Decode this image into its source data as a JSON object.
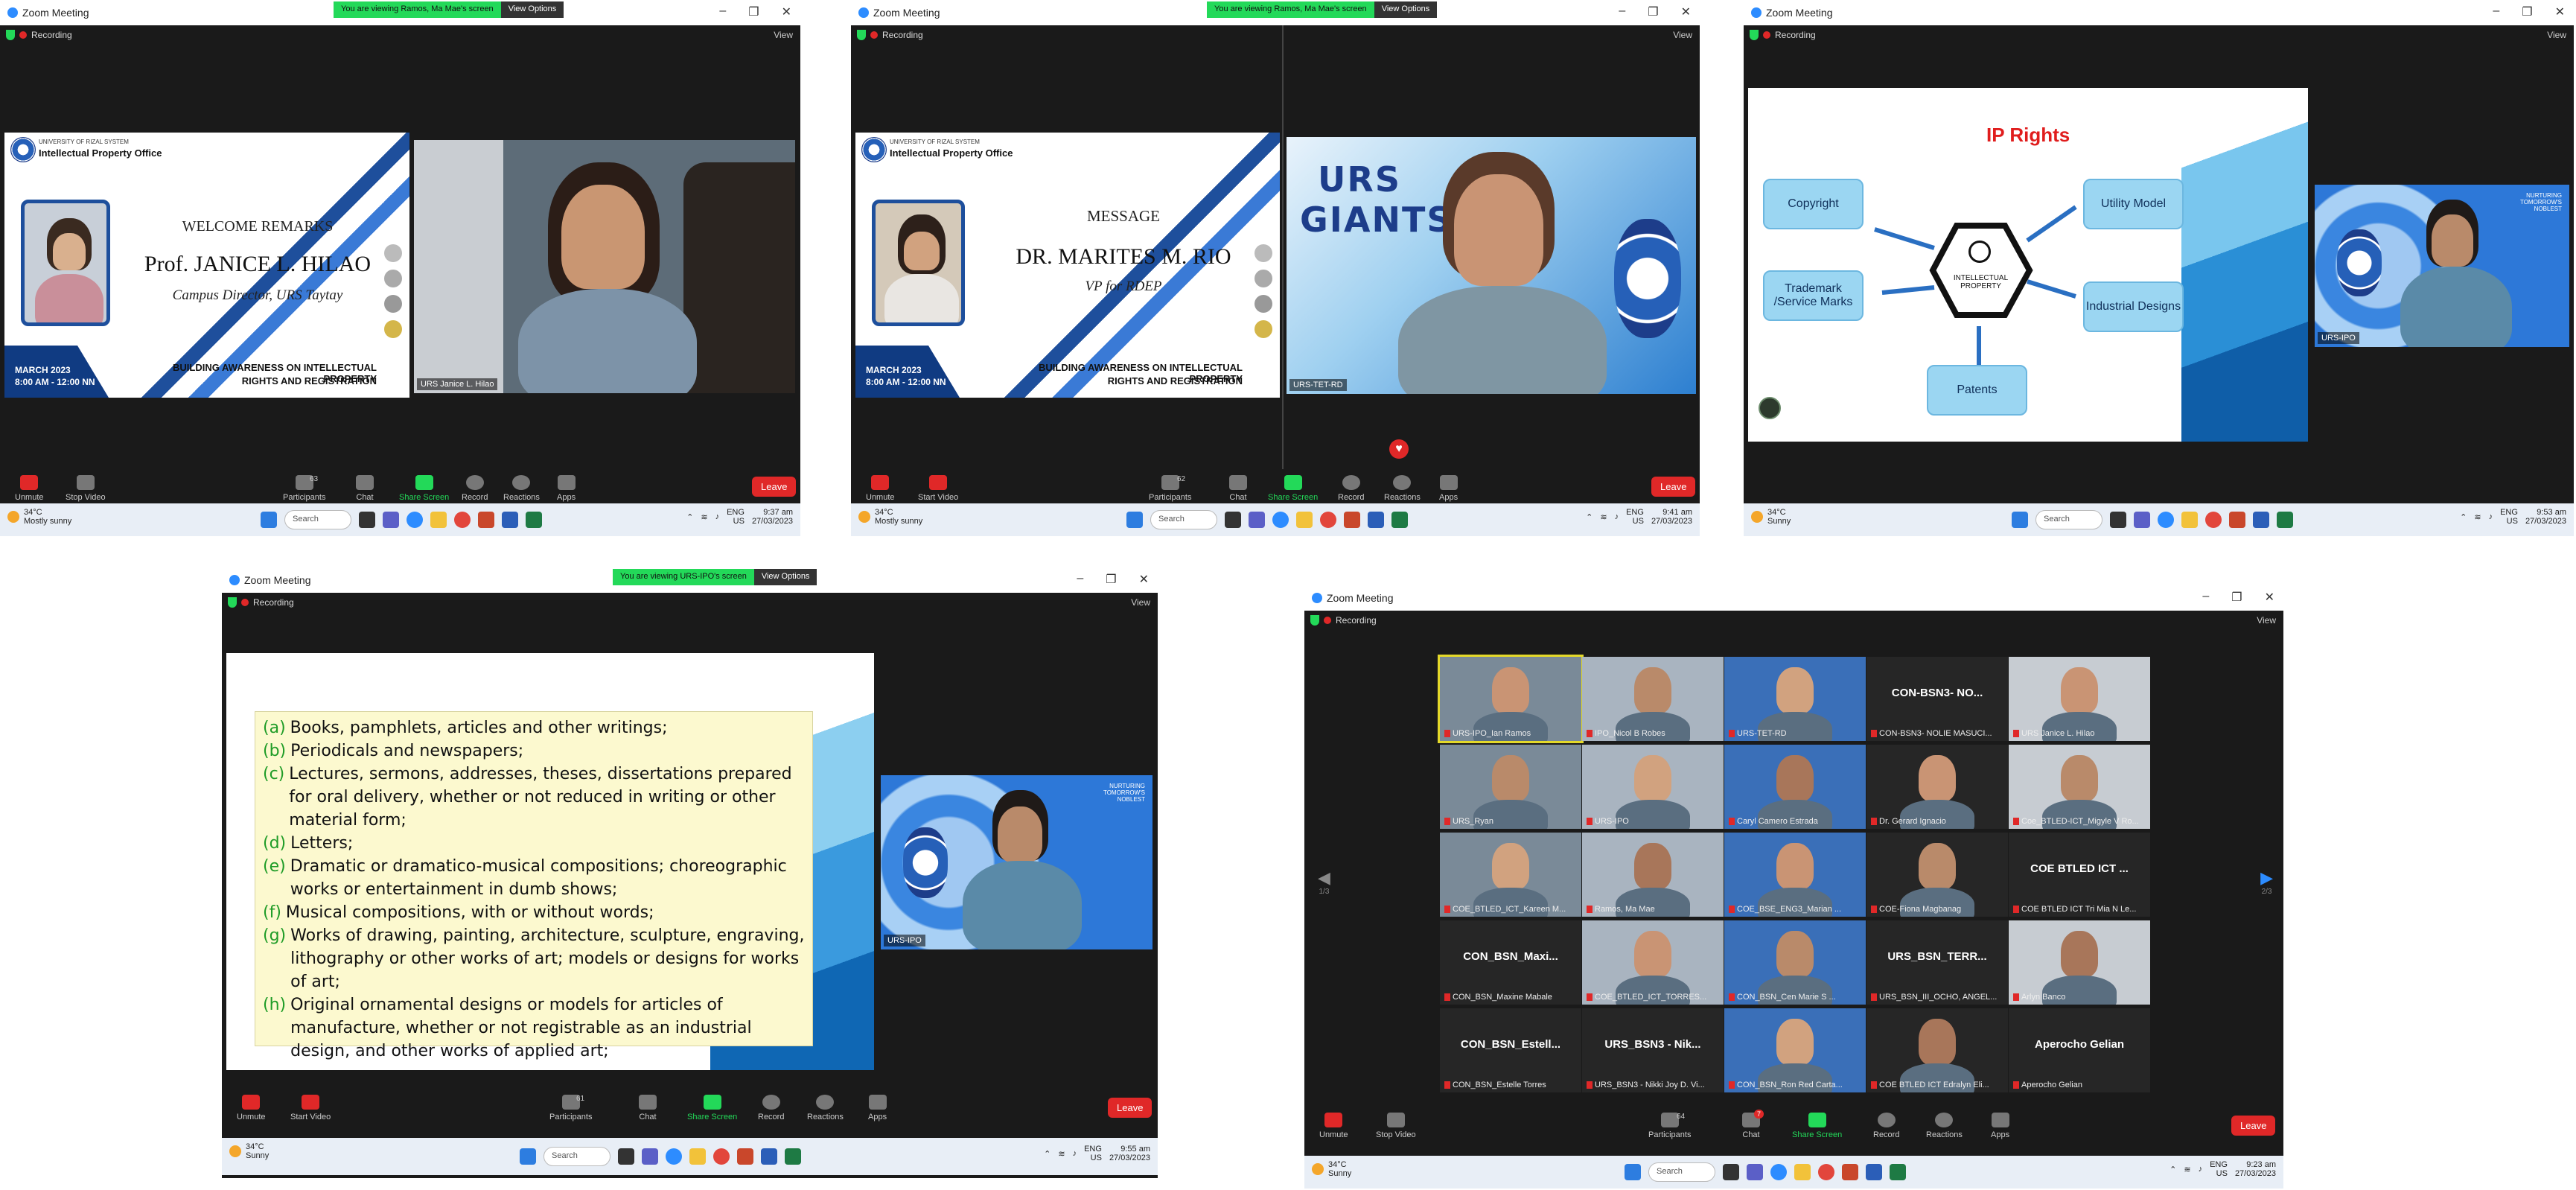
{
  "common": {
    "app_title": "Zoom Meeting",
    "recording": "Recording",
    "view": "View",
    "view_options": "View Options",
    "leave": "Leave",
    "toolbar": {
      "unmute": "Unmute",
      "stop_video": "Stop Video",
      "start_video": "Start Video",
      "participants": "Participants",
      "chat": "Chat",
      "share_screen": "Share Screen",
      "record": "Record",
      "reactions": "Reactions",
      "apps": "Apps"
    },
    "taskbar": {
      "search": "Search",
      "lang": "ENG",
      "region": "US",
      "date": "27/03/2023"
    }
  },
  "panel1": {
    "share_notice": "You are viewing Ramos, Ma Mae's screen",
    "participants_count": "63",
    "slide": {
      "university": "UNIVERSITY OF RIZAL SYSTEM",
      "office": "Intellectual Property Office",
      "heading": "WELCOME REMARKS",
      "speaker": "Prof. JANICE L. HILAO",
      "role": "Campus Director, URS Taytay",
      "date1": "MARCH 2023",
      "date2": "8:00 AM - 12:00 NN",
      "event1": "BUILDING AWARENESS ON INTELLECTUAL PROPERTY",
      "event2": "RIGHTS AND REGISTRATION"
    },
    "video_label": "URS Janice L. Hilao",
    "weather_temp": "34°C",
    "weather_desc": "Mostly sunny",
    "time": "9:37 am"
  },
  "panel2": {
    "share_notice": "You are viewing Ramos, Ma Mae's screen",
    "participants_count": "62",
    "slide": {
      "university": "UNIVERSITY OF RIZAL SYSTEM",
      "office": "Intellectual Property Office",
      "heading": "MESSAGE",
      "speaker": "DR. MARITES M. RIO",
      "role": "VP for RDEP",
      "date1": "MARCH 2023",
      "date2": "8:00 AM - 12:00 NN",
      "event1": "BUILDING AWARENESS ON INTELLECTUAL PROPERTY",
      "event2": "RIGHTS AND REGISTRATION"
    },
    "video_label": "URS-TET-RD",
    "video_logo": "URS GIANTS",
    "weather_temp": "34°C",
    "weather_desc": "Mostly sunny",
    "time": "9:41 am"
  },
  "panel3": {
    "slide": {
      "title": "IP Rights",
      "center": "INTELLECTUAL PROPERTY",
      "copyright": "Copyright",
      "trademark": "Trademark /Service Marks",
      "patents": "Patents",
      "utility": "Utility Model",
      "industrial": "Industrial Designs"
    },
    "video_label": "URS-IPO",
    "video_banner": "NURTURING TOMORROW'S NOBLEST",
    "weather_temp": "34°C",
    "weather_desc": "Sunny",
    "time": "9:53 am"
  },
  "panel4": {
    "share_notice": "You are viewing URS-IPO's screen",
    "participants_count": "61",
    "slide_items": [
      {
        "letter": "(a)",
        "text": "Books, pamphlets, articles and other writings;"
      },
      {
        "letter": "(b)",
        "text": "Periodicals and newspapers;"
      },
      {
        "letter": "(c)",
        "text": "Lectures, sermons, addresses, theses, dissertations prepared for oral delivery,  whether or not reduced in writing or other material form;"
      },
      {
        "letter": "(d)",
        "text": "Letters;"
      },
      {
        "letter": "(e)",
        "text": "Dramatic or dramatico-musical compositions; choreographic works or entertainment in dumb shows;"
      },
      {
        "letter": "(f)",
        "text": "Musical compositions, with or without words;"
      },
      {
        "letter": "(g)",
        "text": "Works of drawing, painting, architecture, sculpture, engraving, lithography or other works of art; models or designs for works of art;"
      },
      {
        "letter": "(h)",
        "text": "Original ornamental designs or models for articles of manufacture, whether  or not registrable as an industrial design, and other works of applied art;"
      }
    ],
    "video_label": "URS-IPO",
    "video_banner": "NURTURING TOMORROW'S NOBLEST",
    "weather_temp": "34°C",
    "weather_desc": "Sunny",
    "time": "9:55 am"
  },
  "panel5": {
    "participants_count": "64",
    "chat_badge": "7",
    "page_left": "1/3",
    "page_right": "2/3",
    "tiles": [
      "URS-IPO_Ian Ramos",
      "IPO_Nicol B Robes",
      "URS-TET-RD",
      "CON-BSN3- NOLIE MASUCI...",
      "URS Janice L. Hilao",
      "URS_Ryan",
      "URS-IPO",
      "Caryl Camero Estrada",
      "Dr. Gerard Ignacio",
      "Coe_BTLED-ICT_Migyle V Ro...",
      "COE_BTLED_ICT_Kareen M...",
      "Ramos, Ma Mae",
      "COE_BSE_ENG3_Marian ...",
      "COE-Fiona Magbanag",
      "COE BTLED ICT Tri Mia N Le...",
      "CON_BSN_Maxine Mabale",
      "COE_BTLED_ICT_TORRES...",
      "CON_BSN_Cen Marie S ...",
      "URS_BSN_III_OCHO, ANGEL...",
      "Arlyn Banco",
      "CON_BSN_Estelle Torres",
      "URS_BSN3 - Nikki Joy D. Vi...",
      "CON_BSN_Ron Red Carta...",
      "COE BTLED ICT Edralyn Eli...",
      "Aperocho Gelian"
    ],
    "tile_big": {
      "3": "CON-BSN3- NO...",
      "14": "COE BTLED ICT ...",
      "15": "CON_BSN_Maxi...",
      "18": "URS_BSN_TERR...",
      "20": "CON_BSN_Estell...",
      "21": "URS_BSN3 - Nik...",
      "24": "Aperocho Gelian"
    },
    "weather_temp": "34°C",
    "weather_desc": "Sunny",
    "time": "9:23 am"
  }
}
